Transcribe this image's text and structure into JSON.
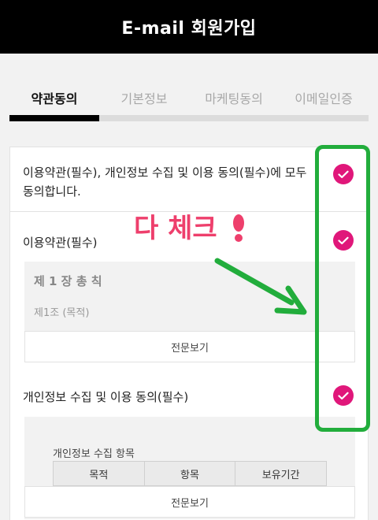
{
  "header": {
    "title": "E-mail 회원가입"
  },
  "tabs": [
    {
      "label": "약관동의",
      "active": true
    },
    {
      "label": "기본정보",
      "active": false
    },
    {
      "label": "마케팅동의",
      "active": false
    },
    {
      "label": "이메일인증",
      "active": false
    }
  ],
  "progress": {
    "step": 1,
    "total": 4
  },
  "agreements": {
    "all_label": "이용약관(필수), 개인정보 수집 및 이용 동의(필수)에 모두 동의합니다.",
    "all_checked": true,
    "terms": {
      "label": "이용약관(필수)",
      "checked": true,
      "chapter": "제 1 장 총 칙",
      "article": "제1조 (목적)",
      "view_full": "전문보기"
    },
    "privacy": {
      "label": "개인정보 수집 및 이용 동의(필수)",
      "checked": true,
      "subhead": "개인정보 수집 항목",
      "columns": [
        "목적",
        "항목",
        "보유기간"
      ],
      "view_full": "전문보기"
    }
  },
  "annotation": {
    "text": "다 체크",
    "mark": "!"
  },
  "colors": {
    "check": "#e0177a",
    "annotation_box": "#22ad3c",
    "annotation_text": "#ee3f6c",
    "header_bg": "#000000"
  }
}
